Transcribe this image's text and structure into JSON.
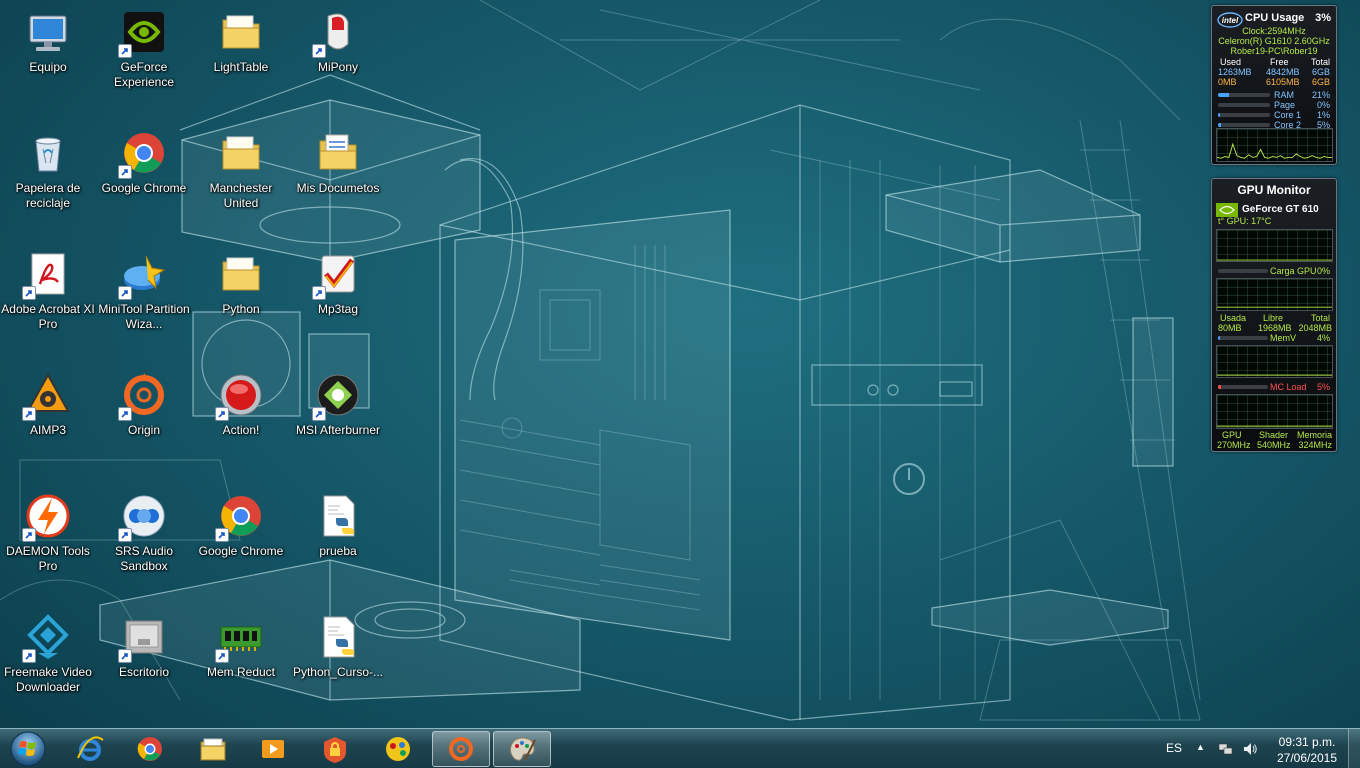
{
  "desktop_icons": [
    {
      "label": "Equipo",
      "icon": "computer-icon"
    },
    {
      "label": "GeForce Experience",
      "icon": "geforce-icon"
    },
    {
      "label": "LightTable",
      "icon": "folder-icon"
    },
    {
      "label": "MiPony",
      "icon": "mipony-icon"
    },
    {
      "label": "Papelera de reciclaje",
      "icon": "recycle-bin-icon"
    },
    {
      "label": "Google Chrome",
      "icon": "chrome-icon"
    },
    {
      "label": "Manchester United",
      "icon": "folder-icon"
    },
    {
      "label": "Mis Documetos",
      "icon": "documents-folder-icon"
    },
    {
      "label": "Adobe Acrobat XI Pro",
      "icon": "acrobat-icon"
    },
    {
      "label": "MiniTool Partition Wiza...",
      "icon": "minitool-icon"
    },
    {
      "label": "Python",
      "icon": "folder-icon"
    },
    {
      "label": "Mp3tag",
      "icon": "mp3tag-icon"
    },
    {
      "label": "AIMP3",
      "icon": "aimp-icon"
    },
    {
      "label": "Origin",
      "icon": "origin-icon"
    },
    {
      "label": "Action!",
      "icon": "action-record-icon"
    },
    {
      "label": "MSI Afterburner",
      "icon": "msi-afterburner-icon"
    },
    {
      "label": "DAEMON Tools Pro",
      "icon": "daemon-tools-icon"
    },
    {
      "label": "SRS Audio Sandbox",
      "icon": "srs-audio-icon"
    },
    {
      "label": "Google Chrome",
      "icon": "chrome-icon"
    },
    {
      "label": "prueba",
      "icon": "python-file-icon"
    },
    {
      "label": "Freemake Video Downloader",
      "icon": "freemake-icon"
    },
    {
      "label": "Escritorio",
      "icon": "desktop-shortcut-icon"
    },
    {
      "label": "Mem Reduct",
      "icon": "mem-reduct-icon"
    },
    {
      "label": "Python_Curso-...",
      "icon": "python-file-icon"
    }
  ],
  "cpu_gadget": {
    "title": "CPU Usage",
    "logo": "intel",
    "usage": "3%",
    "clock": "Clock:2594MHz",
    "cpu_name": "Celeron(R) G1610 2.60GHz",
    "machine": "Rober19-PC\\Rober19",
    "headers": [
      "Used",
      "Free",
      "Total"
    ],
    "ram_row": [
      "1263MB",
      "4842MB",
      "6GB"
    ],
    "page_row": [
      "0MB",
      "6105MB",
      "6GB"
    ],
    "meters": [
      {
        "label": "RAM",
        "value": "21%",
        "fraction": 0.21
      },
      {
        "label": "Page",
        "value": "0%",
        "fraction": 0.0
      },
      {
        "label": "Core 1",
        "value": "1%",
        "fraction": 0.01
      },
      {
        "label": "Core 2",
        "value": "5%",
        "fraction": 0.05
      }
    ],
    "history": [
      3,
      2,
      4,
      3,
      18,
      5,
      3,
      2,
      6,
      3,
      4,
      12,
      3,
      2,
      4,
      3,
      5,
      2,
      3,
      3,
      7,
      4,
      2,
      3,
      5,
      3,
      2,
      4,
      3,
      3
    ]
  },
  "gpu_gadget": {
    "title": "GPU Monitor",
    "gpu_name": "GeForce GT 610",
    "temp": "t° GPU: 17°C",
    "load_label": "Carga GPU",
    "load_value": "0%",
    "mem_headers": [
      "Usada",
      "Libre",
      "Total"
    ],
    "mem_values": [
      "80MB",
      "1968MB",
      "2048MB"
    ],
    "memv_label": "MemV",
    "memv_value": "4%",
    "mc_label": "MC Load",
    "mc_value": "5%",
    "clock_headers": [
      "GPU",
      "Shader",
      "Memoria"
    ],
    "clock_values": [
      "270MHz",
      "540MHz",
      "324MHz"
    ]
  },
  "taskbar": {
    "pinned": [
      {
        "name": "internet-explorer",
        "icon": "ie-icon"
      },
      {
        "name": "google-chrome",
        "icon": "chrome-icon"
      },
      {
        "name": "windows-explorer",
        "icon": "explorer-icon"
      },
      {
        "name": "media-player",
        "icon": "media-player-icon"
      },
      {
        "name": "security-app",
        "icon": "lock-app-icon"
      },
      {
        "name": "paint-app",
        "icon": "paint-icon"
      },
      {
        "name": "origin",
        "icon": "origin-icon",
        "active": true
      },
      {
        "name": "paint-classic",
        "icon": "palette-icon",
        "active": true
      }
    ],
    "language": "ES",
    "time": "09:31 p.m.",
    "date": "27/06/2015"
  },
  "colors": {
    "wallpaper": "#16596a",
    "taskbar": "#1e4450",
    "gadget_accent": "#b5e84a"
  }
}
